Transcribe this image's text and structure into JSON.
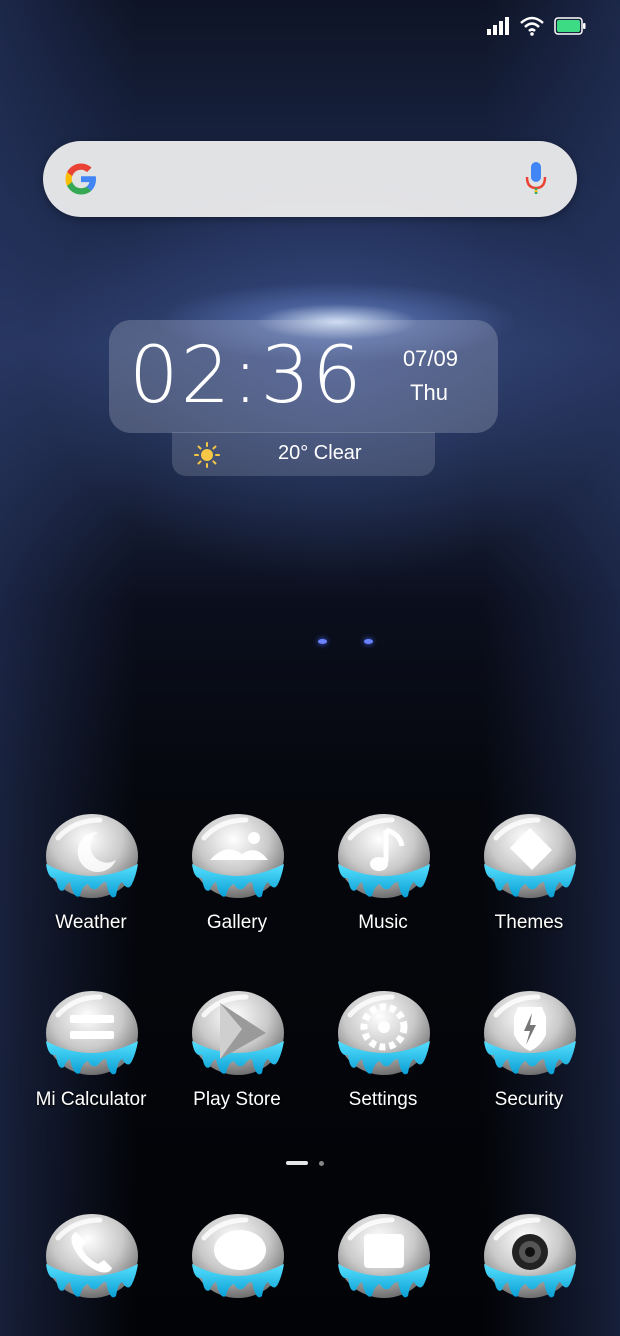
{
  "status_bar": {
    "signal_icon": "signal-icon",
    "wifi_icon": "wifi-icon",
    "battery_icon": "battery-icon",
    "battery_color": "#3ddc84"
  },
  "search": {
    "logo": "google-icon",
    "mic_icon": "mic-icon"
  },
  "clock": {
    "time": "02:36",
    "date": "07/09",
    "day": "Thu"
  },
  "weather": {
    "icon": "sun-icon",
    "text": "20° Clear"
  },
  "apps": [
    {
      "label": "Weather",
      "icon": "weather-icon"
    },
    {
      "label": "Gallery",
      "icon": "gallery-icon"
    },
    {
      "label": "Music",
      "icon": "music-icon"
    },
    {
      "label": "Themes",
      "icon": "themes-icon"
    },
    {
      "label": "Mi Calculator",
      "icon": "calculator-icon"
    },
    {
      "label": "Play Store",
      "icon": "play-store-icon"
    },
    {
      "label": "Settings",
      "icon": "settings-icon"
    },
    {
      "label": "Security",
      "icon": "security-icon"
    }
  ],
  "dock": [
    {
      "icon": "phone-icon"
    },
    {
      "icon": "messages-icon"
    },
    {
      "icon": "browser-icon"
    },
    {
      "icon": "camera-icon"
    }
  ],
  "pager": {
    "pages": 2,
    "current": 1
  },
  "theme_colors": {
    "drip": "#19c3ee",
    "bubble": "#d9d9d9"
  }
}
